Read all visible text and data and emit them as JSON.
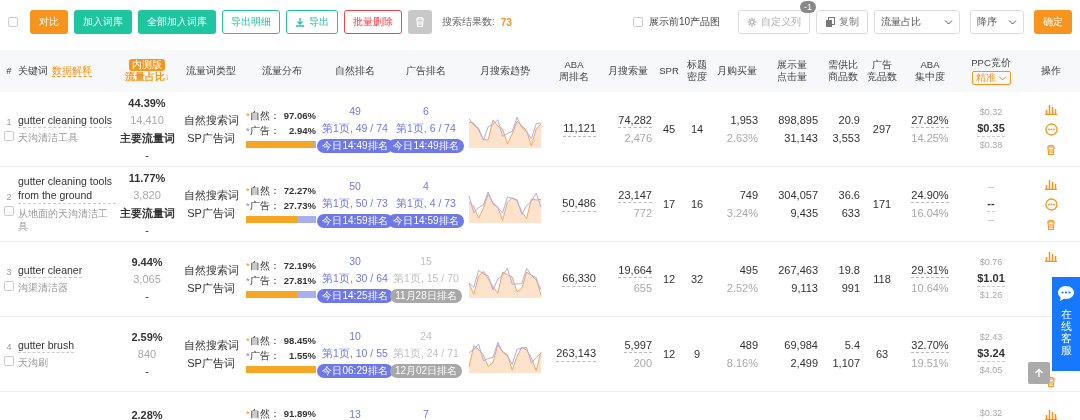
{
  "toolbar": {
    "select_all": {
      "checked": false
    },
    "buttons": [
      {
        "label": "对比",
        "kind": "primary"
      },
      {
        "label": "加入词库",
        "kind": "success"
      },
      {
        "label": "全部加入词库",
        "kind": "success"
      },
      {
        "label": "导出明细",
        "kind": "outline"
      },
      {
        "label": "导出",
        "kind": "export"
      },
      {
        "label": "批量删除",
        "kind": "danger"
      },
      {
        "kind": "trash"
      }
    ],
    "result_label": "搜索结果数:",
    "result_count": "73",
    "show_images": {
      "label": "展示前10产品图",
      "checked": false
    },
    "custom_columns": {
      "label": "自定义列",
      "badge": "-1",
      "disabled": true
    },
    "copy": {
      "label": "复制"
    },
    "sort_field": "流量占比",
    "sort_order": "降序",
    "confirm": "确定"
  },
  "columns": [
    {
      "lines": [
        "#"
      ]
    },
    {
      "lines": [
        "关键词"
      ],
      "link": "数据解释"
    },
    {
      "lines": [
        "流量占比↓"
      ],
      "badge": "内测版",
      "sorted": true
    },
    {
      "lines": [
        "流量词类型"
      ]
    },
    {
      "lines": [
        "流量分布"
      ]
    },
    {
      "lines": [
        "自然排名"
      ]
    },
    {
      "lines": [
        "广告排名"
      ]
    },
    {
      "lines": [
        "月搜索趋势"
      ]
    },
    {
      "lines": [
        "ABA",
        "周排名"
      ]
    },
    {
      "lines": [
        "月搜索量"
      ]
    },
    {
      "lines": [
        "SPR"
      ]
    },
    {
      "lines": [
        "标题",
        "密度"
      ]
    },
    {
      "lines": [
        "月购买量"
      ]
    },
    {
      "lines": [
        "展示量",
        "点击量"
      ]
    },
    {
      "lines": [
        "需供比",
        "商品数"
      ]
    },
    {
      "lines": [
        "广告",
        "竞品数"
      ]
    },
    {
      "lines": [
        "ABA",
        "集中度"
      ]
    },
    {
      "lines": [
        "PPC竞价"
      ],
      "dropdown": "精准"
    },
    {
      "lines": [
        "操作"
      ]
    }
  ],
  "rows": [
    {
      "index": "1",
      "selected": false,
      "keyword": "gutter cleaning tools",
      "translation": "天沟清洁工具",
      "share": "44.39%",
      "share_count": "14,410",
      "role": "主要流量词",
      "share_note": "-",
      "types": [
        "自然搜索词",
        "SP广告词"
      ],
      "natural_mark": "*",
      "natural_label": "自然：",
      "natural_pct": "97.06%",
      "ad_mark": "*",
      "ad_label": "广告：",
      "ad_pct": "2.94%",
      "level": 0.9706,
      "organic": {
        "rank": "49",
        "page": "第1页, 49 / 74",
        "badge": "今日14:49排名",
        "fresh": true
      },
      "ad": {
        "rank": "6",
        "page": "第1页, 6 / 74",
        "badge": "今日14:49排名",
        "fresh": true
      },
      "aba": "11,121",
      "search": "74,282",
      "search_sub": "2,476",
      "spr": "45",
      "density": "14",
      "buy": "1,953",
      "buy_rate": "2.63%",
      "impressions": "898,895",
      "clicks": "31,143",
      "demand": "20.9",
      "products": "3,553",
      "ad_products": "297",
      "concentration": "27.82%",
      "concentration_sub": "14.25%",
      "ppc": [
        "$0.32",
        "$0.35",
        "$0.38"
      ]
    },
    {
      "index": "2",
      "selected": false,
      "keyword": "gutter cleaning tools from the ground",
      "translation": "从地面的天沟清洁工具",
      "share": "11.77%",
      "share_count": "3,820",
      "role": "主要流量词",
      "share_note": "-",
      "types": [
        "自然搜索词",
        "SP广告词"
      ],
      "natural_mark": "*",
      "natural_label": "自然：",
      "natural_pct": "72.27%",
      "ad_mark": "*",
      "ad_label": "广告：",
      "ad_pct": "27.73%",
      "level": 0.7227,
      "organic": {
        "rank": "50",
        "page": "第1页, 50 / 73",
        "badge": "今日14:59排名",
        "fresh": true
      },
      "ad": {
        "rank": "4",
        "page": "第1页, 4 / 73",
        "badge": "今日14:59排名",
        "fresh": true
      },
      "aba": "50,486",
      "search": "23,147",
      "search_sub": "772",
      "spr": "17",
      "density": "16",
      "buy": "749",
      "buy_rate": "3.24%",
      "impressions": "304,057",
      "clicks": "9,435",
      "demand": "36.6",
      "products": "633",
      "ad_products": "171",
      "concentration": "24.90%",
      "concentration_sub": "16.04%",
      "ppc": [
        "--",
        "--",
        "--"
      ]
    },
    {
      "index": "3",
      "selected": false,
      "keyword": "gutter cleaner",
      "translation": "沟渠清洁器",
      "share": "9.44%",
      "share_count": "3,065",
      "share_note": "-",
      "types": [
        "自然搜索词",
        "SP广告词"
      ],
      "natural_mark": "*",
      "natural_label": "自然：",
      "natural_pct": "72.19%",
      "ad_mark": "*",
      "ad_label": "广告：",
      "ad_pct": "27.81%",
      "level": 0.7219,
      "organic": {
        "rank": "30",
        "page": "第1页, 30 / 64",
        "badge": "今日14:25排名",
        "fresh": true
      },
      "ad": {
        "rank": "15",
        "page": "第1页, 15 / 70",
        "badge": "11月28日排名",
        "fresh": false
      },
      "aba": "66,330",
      "search": "19,664",
      "search_sub": "655",
      "spr": "12",
      "density": "32",
      "buy": "495",
      "buy_rate": "2.52%",
      "impressions": "267,463",
      "clicks": "9,113",
      "demand": "19.8",
      "products": "991",
      "ad_products": "118",
      "concentration": "29.31%",
      "concentration_sub": "10.64%",
      "ppc": [
        "$0.76",
        "$1.01",
        "$1.26"
      ]
    },
    {
      "index": "4",
      "selected": false,
      "keyword": "gutter brush",
      "translation": "天沟刷",
      "share": "2.59%",
      "share_count": "840",
      "share_note": "-",
      "types": [
        "自然搜索词",
        "SP广告词"
      ],
      "natural_mark": "*",
      "natural_label": "自然：",
      "natural_pct": "98.45%",
      "ad_mark": "*",
      "ad_label": "广告：",
      "ad_pct": "1.55%",
      "level": 0.9845,
      "organic": {
        "rank": "10",
        "page": "第1页, 10 / 55",
        "badge": "今日06:29排名",
        "fresh": true
      },
      "ad": {
        "rank": "24",
        "page": "第1页, 24 / 71",
        "badge": "12月02日排名",
        "fresh": false
      },
      "aba": "263,143",
      "search": "5,997",
      "search_sub": "200",
      "spr": "12",
      "density": "9",
      "buy": "489",
      "buy_rate": "8.16%",
      "impressions": "69,984",
      "clicks": "2,499",
      "demand": "5.4",
      "products": "1,107",
      "ad_products": "63",
      "concentration": "32.70%",
      "concentration_sub": "19.51%",
      "ppc": [
        "$2.43",
        "$3.24",
        "$4.05"
      ]
    },
    {
      "share": "2.28%",
      "natural_mark": "*",
      "natural_label": "自然：",
      "natural_pct": "91.89%",
      "organic": {
        "rank": "13"
      },
      "ad": {
        "rank": "7"
      },
      "ppc": [
        "$0.32"
      ]
    }
  ],
  "chat": {
    "label": "在线客服"
  }
}
